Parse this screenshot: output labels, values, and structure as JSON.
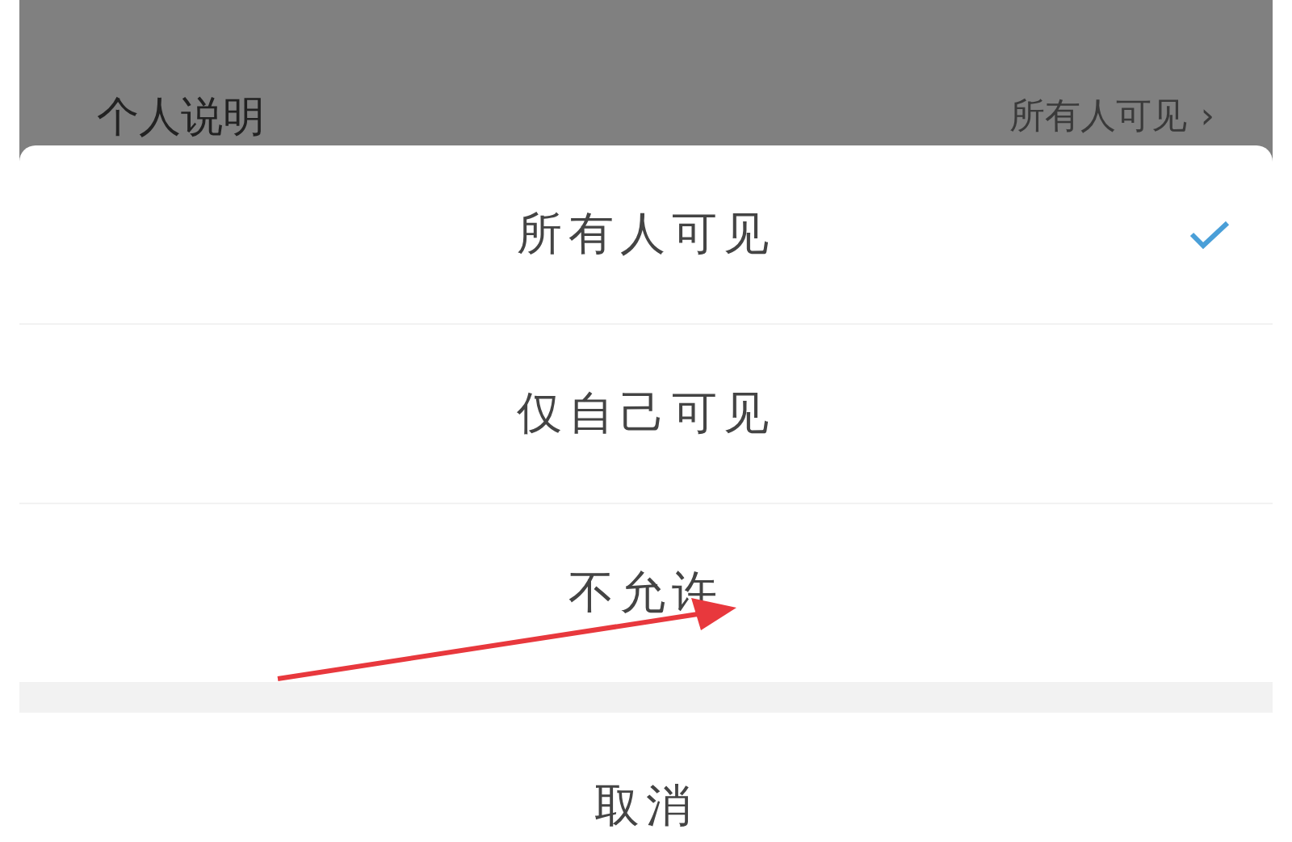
{
  "background_row": {
    "label": "个人说明",
    "value": "所有人可见",
    "chevron": "›"
  },
  "options": [
    {
      "label": "所有人可见",
      "selected": true
    },
    {
      "label": "仅自己可见",
      "selected": false
    },
    {
      "label": "不允许",
      "selected": false
    }
  ],
  "cancel": "取消"
}
